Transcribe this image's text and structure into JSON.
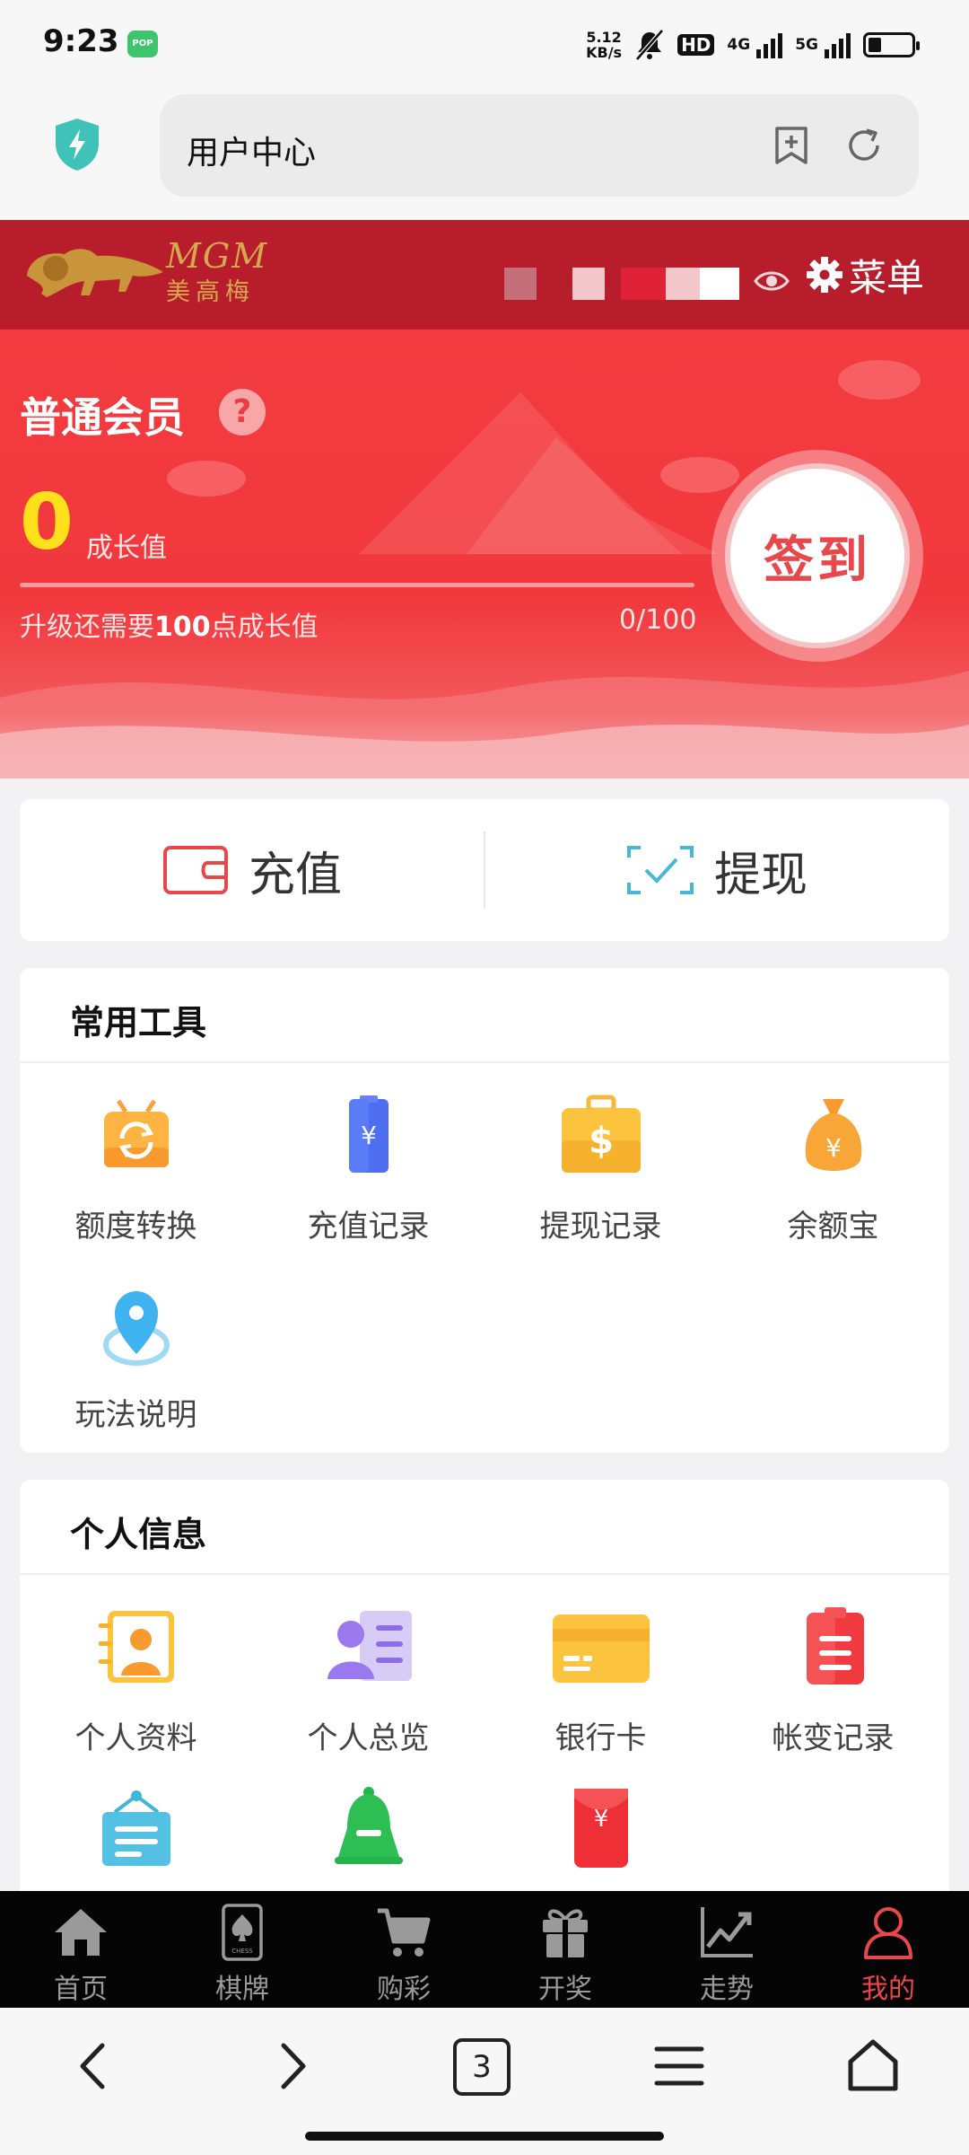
{
  "status_bar": {
    "time": "9:23",
    "app_badge": "POP",
    "net_speed_value": "5.12",
    "net_speed_unit": "KB/s",
    "hd": "HD",
    "net_1": "4G",
    "net_2": "5G"
  },
  "browser": {
    "url_text": "用户中心",
    "tab_count": "3"
  },
  "site_header": {
    "logo_en": "MGM",
    "logo_cn": "美高梅",
    "menu_label": "菜单"
  },
  "member": {
    "level_title": "普通会员",
    "help_symbol": "?",
    "growth_value": "0",
    "growth_label": "成长值",
    "upgrade_prefix": "升级还需要",
    "upgrade_points": "100",
    "upgrade_suffix": "点成长值",
    "progress_text": "0/100",
    "progress_fraction": 0,
    "signin_label": "签到"
  },
  "wallet": {
    "recharge_label": "充值",
    "withdraw_label": "提现"
  },
  "tools": {
    "title": "常用工具",
    "items": [
      {
        "label": "额度转换",
        "icon": "transfer-icon"
      },
      {
        "label": "充值记录",
        "icon": "recharge-record-icon"
      },
      {
        "label": "提现记录",
        "icon": "withdraw-record-icon"
      },
      {
        "label": "余额宝",
        "icon": "money-bag-icon"
      },
      {
        "label": "玩法说明",
        "icon": "location-pin-icon"
      }
    ]
  },
  "personal": {
    "title": "个人信息",
    "items": [
      {
        "label": "个人资料",
        "icon": "contact-card-icon"
      },
      {
        "label": "个人总览",
        "icon": "profile-overview-icon"
      },
      {
        "label": "银行卡",
        "icon": "bank-card-icon"
      },
      {
        "label": "帐变记录",
        "icon": "clipboard-icon"
      }
    ]
  },
  "bottom_nav": {
    "items": [
      {
        "label": "首页",
        "icon": "home-icon"
      },
      {
        "label": "棋牌",
        "icon": "chess-card-icon"
      },
      {
        "label": "购彩",
        "icon": "cart-icon"
      },
      {
        "label": "开奖",
        "icon": "gift-icon"
      },
      {
        "label": "走势",
        "icon": "trend-icon"
      },
      {
        "label": "我的",
        "icon": "user-icon"
      }
    ],
    "chess_card_text": "CHESS"
  },
  "colors": {
    "brand_red": "#b81d2c",
    "banner_red": "#f23c40",
    "accent_yellow": "#ffe01a",
    "active_nav": "#e8474b"
  }
}
